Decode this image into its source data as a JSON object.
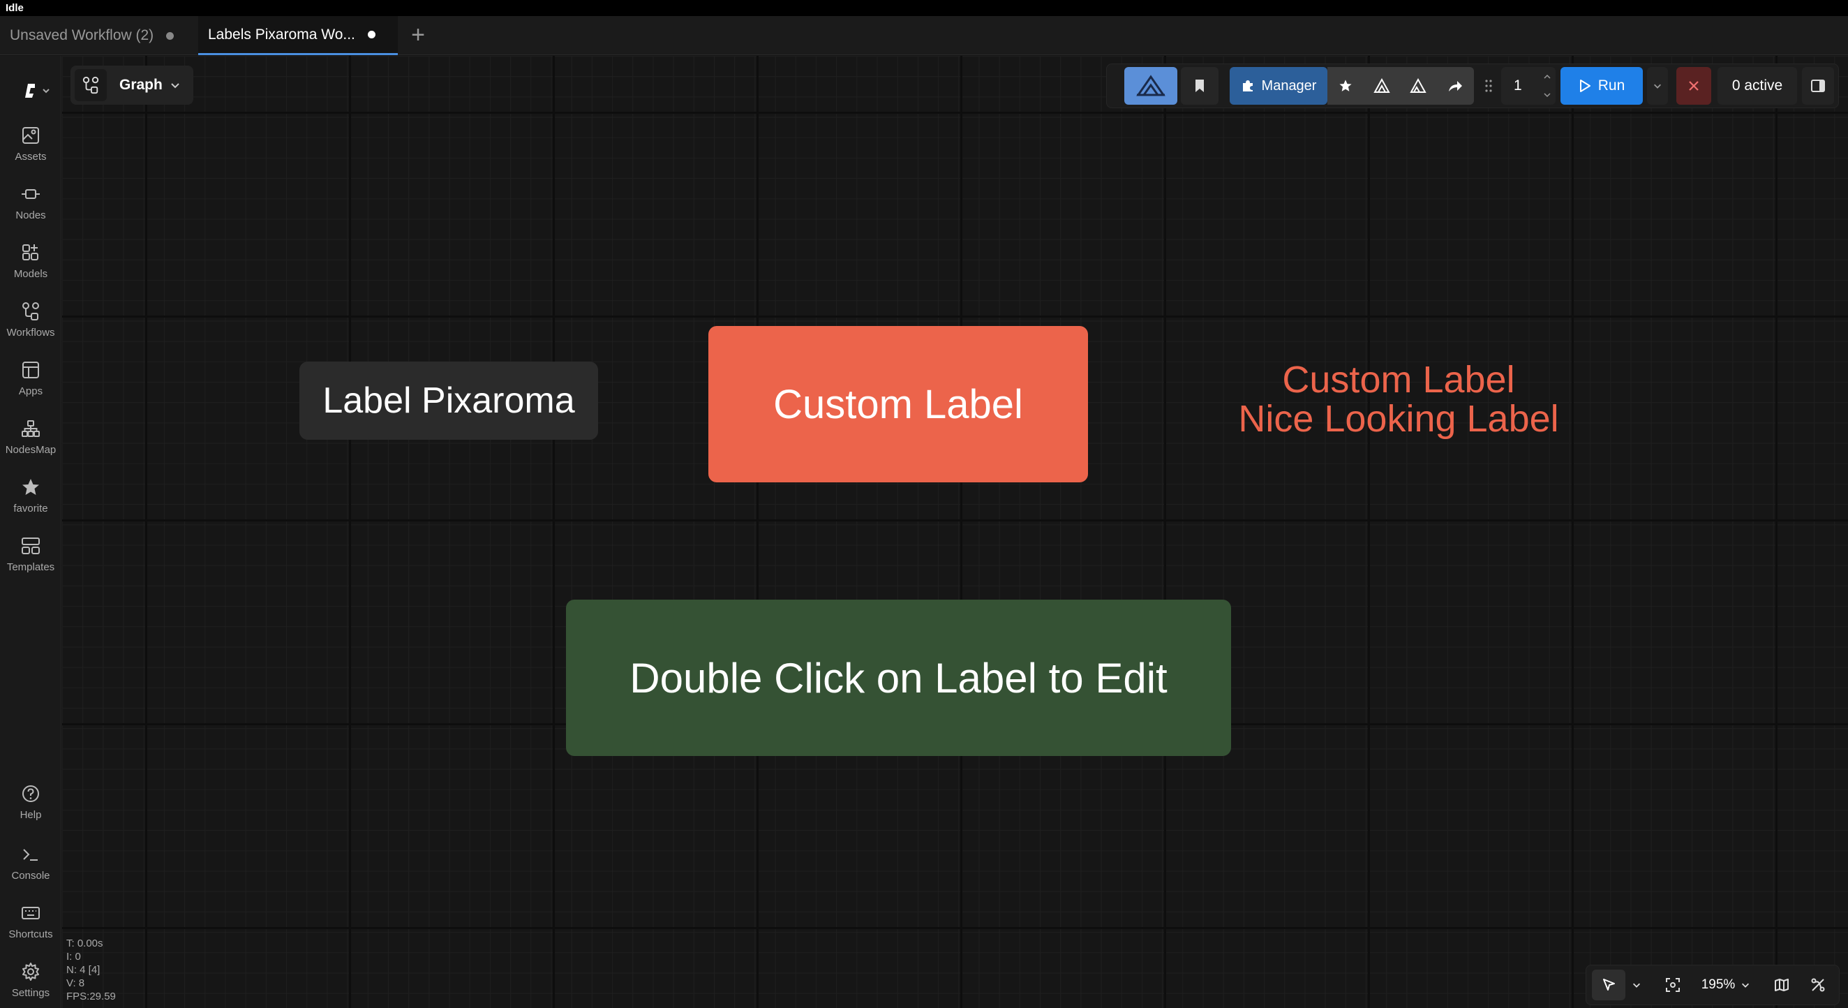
{
  "status": "Idle",
  "tabs": [
    {
      "label": "Unsaved Workflow (2)",
      "active": false
    },
    {
      "label": "Labels Pixaroma Wo...",
      "active": true
    }
  ],
  "sidebar": {
    "top": [
      {
        "label": "Assets",
        "icon": "image-icon"
      },
      {
        "label": "Nodes",
        "icon": "node-icon"
      },
      {
        "label": "Models",
        "icon": "models-icon"
      },
      {
        "label": "Workflows",
        "icon": "workflow-icon"
      },
      {
        "label": "Apps",
        "icon": "apps-icon"
      },
      {
        "label": "NodesMap",
        "icon": "nodesmap-icon"
      },
      {
        "label": "favorite",
        "icon": "star-icon"
      },
      {
        "label": "Templates",
        "icon": "templates-icon"
      }
    ],
    "bottom": [
      {
        "label": "Help",
        "icon": "help-icon"
      },
      {
        "label": "Console",
        "icon": "console-icon"
      },
      {
        "label": "Shortcuts",
        "icon": "keyboard-icon"
      },
      {
        "label": "Settings",
        "icon": "gear-icon"
      }
    ]
  },
  "graph_menu": {
    "label": "Graph"
  },
  "toolbar": {
    "manager_label": "Manager",
    "queue_count": "1",
    "run_label": "Run",
    "active_label": "0 active"
  },
  "canvas_labels": {
    "label_pixaroma": "Label Pixaroma",
    "custom_label": "Custom Label",
    "text_line1": "Custom Label",
    "text_line2": "Nice Looking Label",
    "green_label": "Double Click on Label to Edit"
  },
  "colors": {
    "orange": "#EC644B",
    "green": "#355234",
    "gray_label": "#2b2b2b",
    "run_blue": "#1f80e8",
    "accent_blue": "#4a8fe0"
  },
  "stats": {
    "t": "T: 0.00s",
    "i": "I: 0",
    "n": "N: 4 [4]",
    "v": "V: 8",
    "fps": "FPS:29.59"
  },
  "zoom": "195%"
}
